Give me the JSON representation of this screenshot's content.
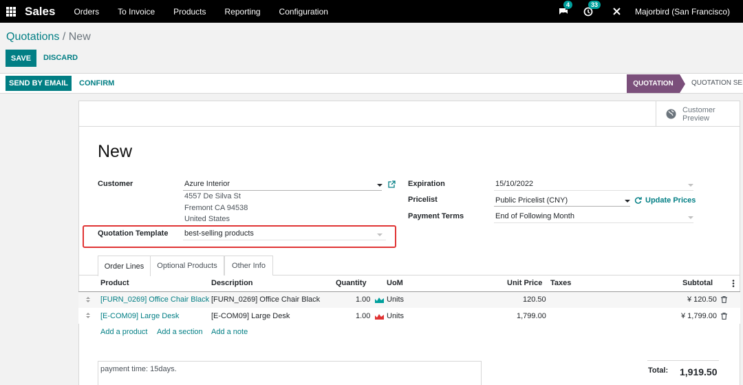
{
  "navbar": {
    "brand": "Sales",
    "menu": [
      "Orders",
      "To Invoice",
      "Products",
      "Reporting",
      "Configuration"
    ],
    "messages_badge": "4",
    "activities_badge": "33",
    "company": "Majorbird (San Francisco)"
  },
  "breadcrumb": {
    "parent": "Quotations",
    "separator": "/",
    "current": "New"
  },
  "buttons": {
    "save": "SAVE",
    "discard": "DISCARD",
    "send_email": "SEND BY EMAIL",
    "confirm": "CONFIRM"
  },
  "status": {
    "active": "QUOTATION",
    "next": "QUOTATION SENT"
  },
  "preview": {
    "line1": "Customer",
    "line2": "Preview"
  },
  "form": {
    "title": "New",
    "customer_label": "Customer",
    "customer_value": "Azure Interior",
    "address": [
      "4557 De Silva St",
      "Fremont CA 94538",
      "United States"
    ],
    "template_label": "Quotation Template",
    "template_value": "best-selling products",
    "expiration_label": "Expiration",
    "expiration_value": "15/10/2022",
    "pricelist_label": "Pricelist",
    "pricelist_value": "Public Pricelist (CNY)",
    "update_prices": "Update Prices",
    "payment_terms_label": "Payment Terms",
    "payment_terms_value": "End of Following Month"
  },
  "tabs": [
    "Order Lines",
    "Optional Products",
    "Other Info"
  ],
  "table": {
    "headers": {
      "product": "Product",
      "description": "Description",
      "quantity": "Quantity",
      "uom": "UoM",
      "unit_price": "Unit Price",
      "taxes": "Taxes",
      "subtotal": "Subtotal"
    },
    "rows": [
      {
        "product": "[FURN_0269] Office Chair Black",
        "description": "[FURN_0269] Office Chair Black",
        "quantity": "1.00",
        "uom": "Units",
        "unit_price": "120.50",
        "subtotal": "¥ 120.50",
        "forecast_color": "#00a09d"
      },
      {
        "product": "[E-COM09] Large Desk",
        "description": "[E-COM09] Large Desk",
        "quantity": "1.00",
        "uom": "Units",
        "unit_price": "1,799.00",
        "subtotal": "¥ 1,799.00",
        "forecast_color": "#e03333"
      }
    ],
    "add_product": "Add a product",
    "add_section": "Add a section",
    "add_note": "Add a note"
  },
  "note": "payment time: 15days.",
  "totals": {
    "label": "Total:",
    "value": "1,919.50"
  }
}
